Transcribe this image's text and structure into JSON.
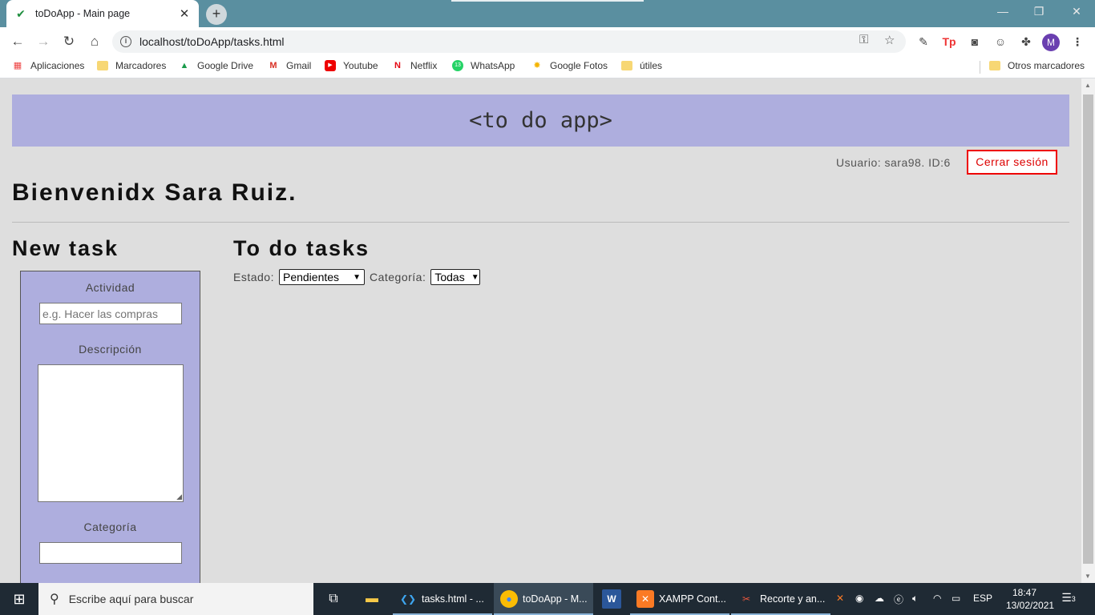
{
  "browser": {
    "tab_title": "toDoApp - Main page",
    "url": "localhost/toDoApp/tasks.html",
    "profile_initial": "M",
    "bookmarks": [
      "Aplicaciones",
      "Marcadores",
      "Google Drive",
      "Gmail",
      "Youtube",
      "Netflix",
      "WhatsApp",
      "Google Fotos",
      "útiles"
    ],
    "other_bookmarks": "Otros marcadores"
  },
  "page": {
    "banner": "<to do app>",
    "user_info": "Usuario: sara98. ID:6",
    "logout_label": "Cerrar sesión",
    "welcome": "Bienvenidx Sara Ruiz.",
    "new_task_heading": "New task",
    "todo_heading": "To do tasks"
  },
  "form": {
    "activity_label": "Actividad",
    "activity_placeholder": "e.g. Hacer las compras",
    "description_label": "Descripción",
    "category_label": "Categoría"
  },
  "filters": {
    "estado_label": "Estado:",
    "estado_value": "Pendientes",
    "categoria_label": "Categoría:",
    "categoria_value": "Todas"
  },
  "taskbar": {
    "search_placeholder": "Escribe aquí para buscar",
    "apps": [
      "tasks.html - ...",
      "toDoApp - M...",
      "XAMPP Cont...",
      "Recorte y an..."
    ],
    "lang": "ESP",
    "time": "18:47",
    "date": "13/02/2021",
    "notifications": "3"
  }
}
